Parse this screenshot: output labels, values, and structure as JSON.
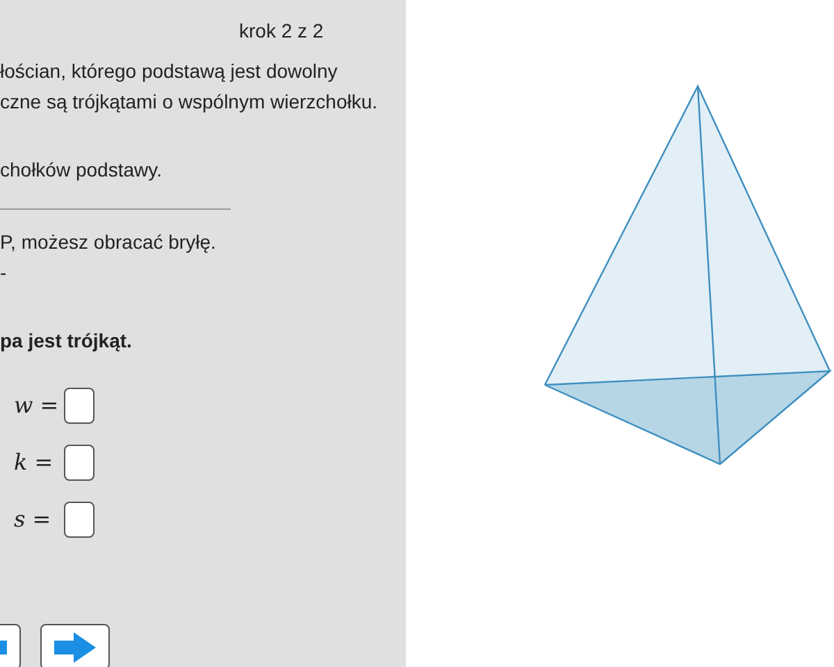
{
  "step": "krok 2 z 2",
  "paragraphs": [
    {
      "kind": "text",
      "lines": [
        "łościan, którego podstawą jest dowolny",
        "czne są trójkątami o wspólnym wierzchołku."
      ]
    },
    {
      "kind": "text",
      "lines": [
        "chołków podstawy."
      ]
    },
    {
      "kind": "rule"
    },
    {
      "kind": "text",
      "lines": [
        "P, możesz obracać bryłę.",
        "-"
      ]
    },
    {
      "kind": "bold",
      "lines": [
        "pa jest trójkąt."
      ]
    }
  ],
  "answers": [
    {
      "label": "w ="
    },
    {
      "label": "k ="
    },
    {
      "label": "s ="
    }
  ],
  "nav_buttons": [
    {
      "kind": "previous"
    },
    {
      "kind": "next"
    }
  ],
  "solid": {
    "kind": "triangular-pyramid"
  }
}
